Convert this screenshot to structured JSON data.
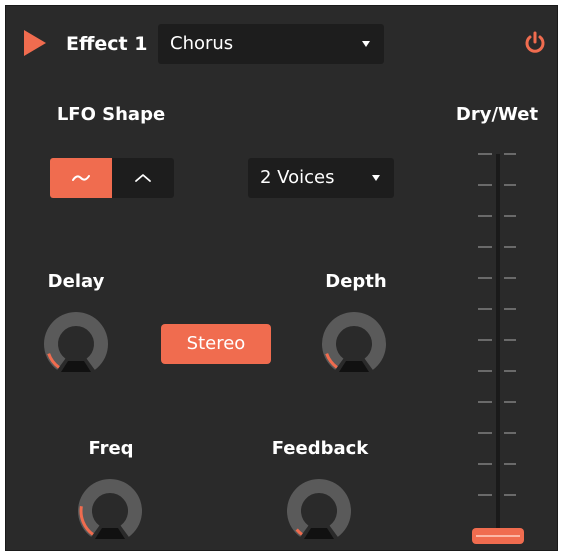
{
  "header": {
    "title": "Effect 1",
    "effect_type": "Chorus",
    "accent_color": "#f06c4f"
  },
  "lfo": {
    "label": "LFO Shape",
    "shapes": [
      {
        "name": "sine",
        "active": true
      },
      {
        "name": "triangle",
        "active": false
      }
    ]
  },
  "voices": {
    "value": "2 Voices"
  },
  "knobs": {
    "delay": {
      "label": "Delay",
      "value": 0.12
    },
    "depth": {
      "label": "Depth",
      "value": 0.12
    },
    "freq": {
      "label": "Freq",
      "value": 0.22
    },
    "feedback": {
      "label": "Feedback",
      "value": 0.05
    }
  },
  "stereo": {
    "label": "Stereo"
  },
  "dry_wet": {
    "label": "Dry/Wet",
    "value": 0.0
  }
}
